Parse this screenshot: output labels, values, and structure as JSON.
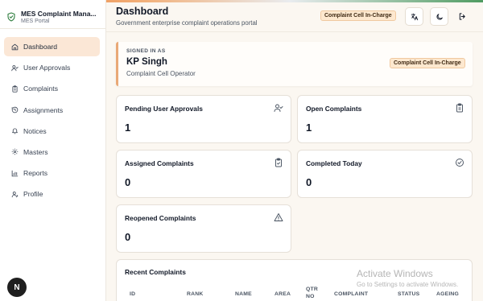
{
  "brand": {
    "title": "MES Complaint Mana...",
    "subtitle": "MES Portal"
  },
  "sidebar": {
    "items": [
      {
        "label": "Dashboard",
        "icon": "home-icon",
        "active": true
      },
      {
        "label": "User Approvals",
        "icon": "user-check-icon"
      },
      {
        "label": "Complaints",
        "icon": "clipboard-icon"
      },
      {
        "label": "Assignments",
        "icon": "history-icon"
      },
      {
        "label": "Notices",
        "icon": "bell-icon"
      },
      {
        "label": "Masters",
        "icon": "gear-icon"
      },
      {
        "label": "Reports",
        "icon": "bar-chart-icon"
      },
      {
        "label": "Profile",
        "icon": "user-icon"
      }
    ]
  },
  "avatar": {
    "initial": "N"
  },
  "header": {
    "title": "Dashboard",
    "subtitle": "Government enterprise complaint operations portal",
    "role_badge": "Complaint Cell In-Charge",
    "buttons": [
      "translate-icon",
      "moon-icon",
      "logout-icon"
    ]
  },
  "signed_in": {
    "label": "SIGNED IN AS",
    "name": "KP Singh",
    "role": "Complaint Cell Operator",
    "badge": "Complaint Cell In-Charge"
  },
  "cards": [
    {
      "title": "Pending User Approvals",
      "value": "1",
      "icon": "user-check-icon"
    },
    {
      "title": "Open Complaints",
      "value": "1",
      "icon": "clipboard-icon"
    },
    {
      "title": "Assigned Complaints",
      "value": "0",
      "icon": "clipboard-check-icon"
    },
    {
      "title": "Completed Today",
      "value": "0",
      "icon": "check-circle-icon"
    },
    {
      "title": "Reopened Complaints",
      "value": "0",
      "icon": "warning-icon"
    }
  ],
  "recent": {
    "title": "Recent Complaints",
    "columns": [
      "ID",
      "RANK",
      "NAME",
      "AREA",
      "QTR NO",
      "COMPLAINT",
      "STATUS",
      "AGEING"
    ]
  },
  "watermark": {
    "line1": "Activate Windows",
    "line2": "Go to Settings to activate Windows."
  },
  "colors": {
    "accent": "#ea7a2f",
    "active_bg": "#fbe7d6",
    "badge_bg": "#fde8cf",
    "brand_green": "#2e7d3e"
  }
}
